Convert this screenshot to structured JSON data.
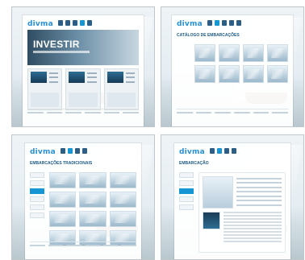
{
  "brand": {
    "logo_text": "divma"
  },
  "screens": [
    {
      "id": "home",
      "hero_title": "INVESTIR"
    },
    {
      "id": "catalog",
      "content_title": "CATÁLOGO DE EMBARCAÇÕES"
    },
    {
      "id": "listing",
      "content_title": "EMBARCAÇÕES TRADICIONAIS"
    },
    {
      "id": "detail",
      "content_title": "EMBARCAÇÃO"
    }
  ],
  "colors": {
    "brand_blue": "#2a8fd0",
    "nav_dark": "#2d5f86",
    "nav_active": "#1696d2"
  }
}
